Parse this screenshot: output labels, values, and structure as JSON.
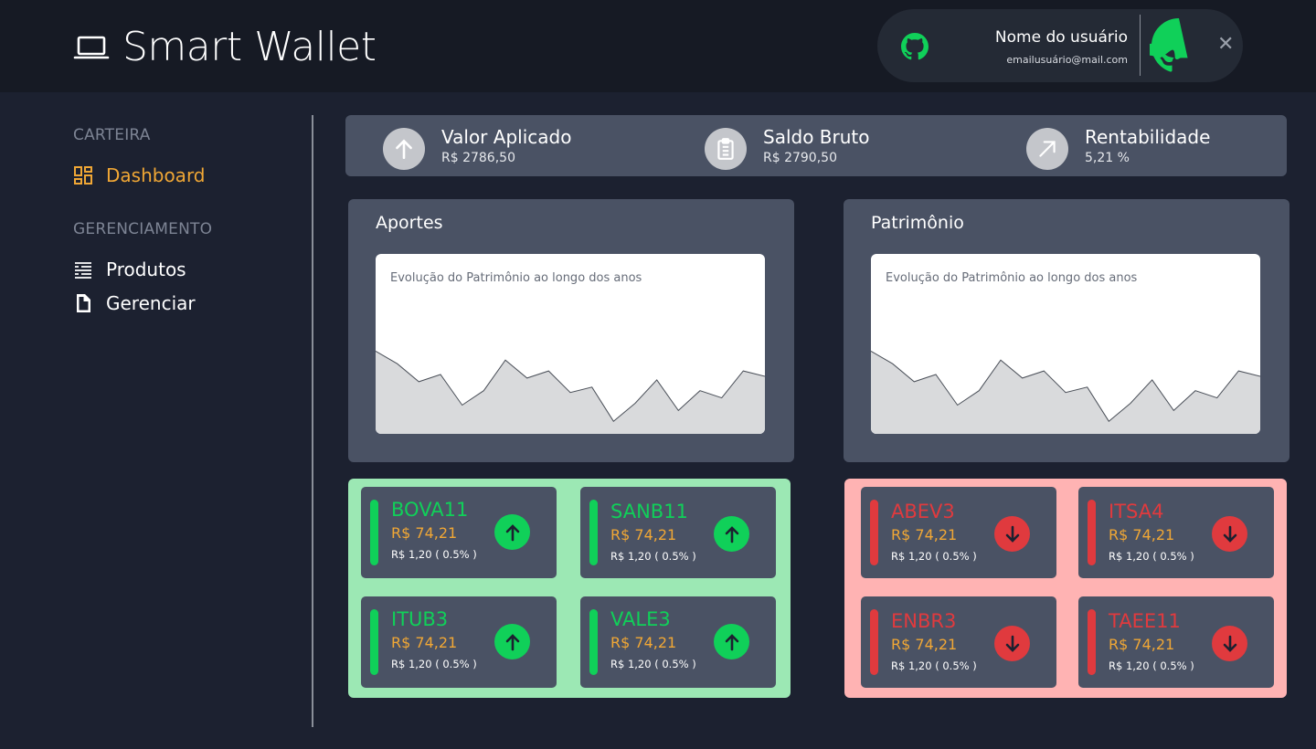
{
  "header": {
    "app_title": "Smart Wallet",
    "user": {
      "name": "Nome do usuário",
      "email": "emailusuário@mail.com",
      "close": "✕"
    }
  },
  "sidebar": {
    "sections": [
      {
        "title": "CARTEIRA",
        "items": [
          {
            "label": "Dashboard",
            "icon": "dashboard-icon",
            "active": true
          }
        ]
      },
      {
        "title": "GERENCIAMENTO",
        "items": [
          {
            "label": "Produtos",
            "icon": "list-icon"
          },
          {
            "label": "Gerenciar",
            "icon": "document-icon"
          }
        ]
      }
    ]
  },
  "summary": [
    {
      "label": "Valor Aplicado",
      "value": "R$ 2786,50",
      "icon": "arrow-up-icon"
    },
    {
      "label": "Saldo Bruto",
      "value": "R$ 2790,50",
      "icon": "clipboard-icon"
    },
    {
      "label": "Rentabilidade",
      "value": "5,21 %",
      "icon": "trend-up-icon"
    }
  ],
  "panels": [
    {
      "title": "Aportes",
      "chart_title": "Evolução do Patrimônio ao longo dos anos"
    },
    {
      "title": "Patrimônio",
      "chart_title": "Evolução do Patrimônio ao longo dos anos"
    }
  ],
  "chart_data": [
    {
      "type": "area",
      "title": "Evolução do Patrimônio ao longo dos anos",
      "values": [
        46,
        39,
        29,
        33,
        16,
        24,
        41,
        31,
        35,
        23,
        26,
        7,
        17,
        30,
        13,
        24,
        20,
        35,
        32
      ],
      "ylim": [
        0,
        100
      ],
      "color": "#d9dadc"
    },
    {
      "type": "area",
      "title": "Evolução do Patrimônio ao longo dos anos",
      "values": [
        46,
        39,
        29,
        33,
        16,
        24,
        41,
        31,
        35,
        23,
        26,
        7,
        17,
        30,
        13,
        24,
        20,
        35,
        32
      ],
      "ylim": [
        0,
        100
      ],
      "color": "#d9dadc"
    }
  ],
  "stocks_up": [
    {
      "ticker": "BOVA11",
      "price": "R$ 74,21",
      "change": "R$ 1,20 ( 0.5% )"
    },
    {
      "ticker": "SANB11",
      "price": "R$ 74,21",
      "change": "R$ 1,20 ( 0.5% )"
    },
    {
      "ticker": "ITUB3",
      "price": "R$ 74,21",
      "change": "R$ 1,20 ( 0.5% )"
    },
    {
      "ticker": "VALE3",
      "price": "R$ 74,21",
      "change": "R$ 1,20 ( 0.5% )"
    }
  ],
  "stocks_down": [
    {
      "ticker": "ABEV3",
      "price": "R$ 74,21",
      "change": "R$ 1,20 ( 0.5% )"
    },
    {
      "ticker": "ITSA4",
      "price": "R$ 74,21",
      "change": "R$ 1,20 ( 0.5% )"
    },
    {
      "ticker": "ENBR3",
      "price": "R$ 74,21",
      "change": "R$ 1,20 ( 0.5% )"
    },
    {
      "ticker": "TAEE11",
      "price": "R$ 74,21",
      "change": "R$ 1,20 ( 0.5% )"
    }
  ],
  "colors": {
    "accent": "#f0a735",
    "positive": "#10d059",
    "negative": "#e03a3e",
    "panel": "#4a5264",
    "background": "#1c2130"
  }
}
